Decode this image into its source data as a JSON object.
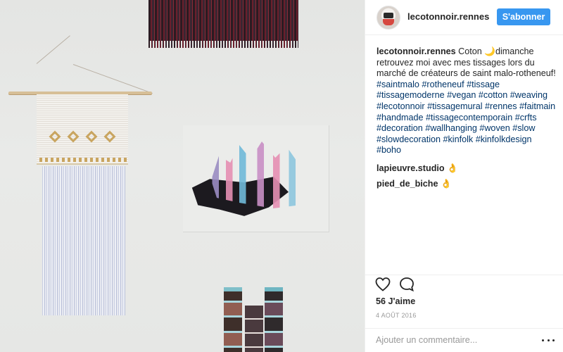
{
  "post": {
    "username": "lecotonnoir.rennes",
    "follow_label": "S'abonner"
  },
  "caption": {
    "username": "lecotonnoir.rennes",
    "text": " Coton 🌙dimanche retrouvez moi avec mes tissages lors du marché de créateurs de saint malo-rotheneuf! ",
    "hashtags": "#saintmalo #rotheneuf #tissage #tissagemoderne #vegan #cotton #weaving #lecotonnoir #tissagemural #rennes #faitmain #handmade #tissagecontemporain #crfts #decoration #wallhanging #woven #slow #slowdecoration #kinfolk #kinfolkdesign #boho"
  },
  "comments": [
    {
      "username": "lapieuvre.studio",
      "text": " 👌"
    },
    {
      "username": "pied_de_biche",
      "text": " 👌"
    }
  ],
  "actions": {
    "like_icon": "heart-icon",
    "comment_icon": "comment-icon"
  },
  "likes": "56 J'aime",
  "date": "4 AOÛT 2016",
  "add_comment": {
    "placeholder": "Ajouter un commentaire...",
    "more_icon": "more-options-icon"
  }
}
